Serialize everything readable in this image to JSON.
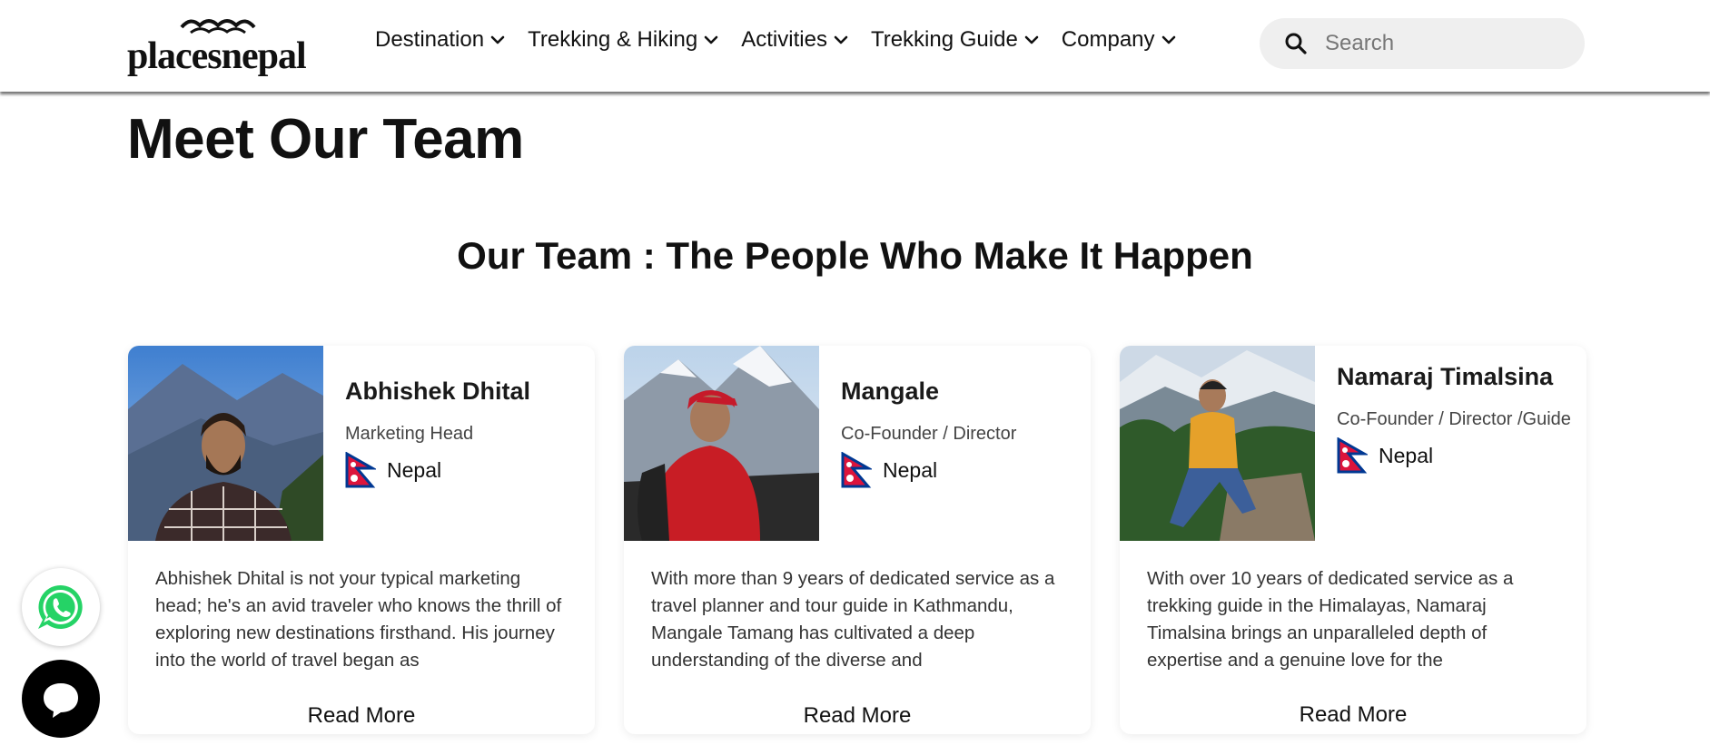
{
  "header": {
    "logo_text": "placesnepal",
    "nav": [
      {
        "label": "Destination"
      },
      {
        "label": "Trekking & Hiking"
      },
      {
        "label": "Activities"
      },
      {
        "label": "Trekking Guide"
      },
      {
        "label": "Company"
      }
    ],
    "search_placeholder": "Search"
  },
  "main": {
    "page_title": "Meet Our Team",
    "section_title": "Our Team : The People Who Make It Happen",
    "team": [
      {
        "name": "Abhishek Dhital",
        "role": "Marketing Head",
        "country": "Nepal",
        "bio": "Abhishek Dhital is not your typical marketing head; he's an avid traveler who knows the thrill of exploring new destinations firsthand. His journey into the world of travel began as",
        "read_more": "Read More"
      },
      {
        "name": "Mangale",
        "role": "Co-Founder / Director",
        "country": "Nepal",
        "bio": "With more than 9 years of dedicated service as a travel planner and tour guide in Kathmandu, Mangale Tamang has cultivated a deep understanding of the diverse and",
        "read_more": "Read More"
      },
      {
        "name": "Namaraj Timalsina",
        "role": "Co-Founder / Director /Guide",
        "country": "Nepal",
        "bio": "With over 10 years of dedicated service as a trekking guide in the Himalayas, Namaraj Timalsina brings an unparalleled depth of expertise and a genuine love for the",
        "read_more": "Read More"
      }
    ]
  },
  "floating": {
    "whatsapp_icon": "whatsapp-icon",
    "chat_icon": "chat-icon"
  },
  "colors": {
    "whatsapp_green": "#25d366",
    "flag_red": "#dc143c",
    "flag_blue": "#003893"
  }
}
